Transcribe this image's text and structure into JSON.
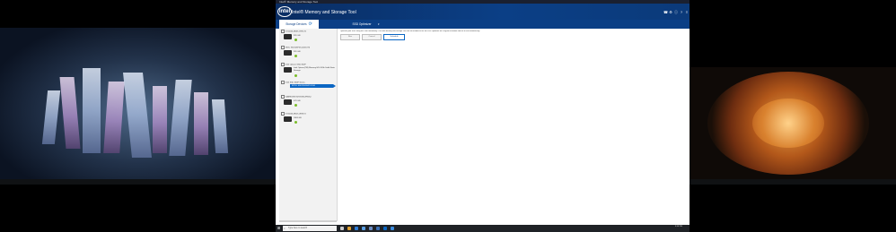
{
  "window": {
    "title": "Intel® Memory and Storage Tool",
    "app_title": "Intel® Memory and Storage Tool",
    "logo_text": "intel"
  },
  "header_icons": [
    "phone-icon",
    "gear-icon",
    "info-icon",
    "question-icon",
    "user-icon",
    "menu-icon"
  ],
  "tabs": {
    "storage_devices": "Storage Devices",
    "ssd_optimizer": "SSD Optimizer"
  },
  "sidebar": {
    "drives": [
      {
        "heading": "ST1000LM035-1RK172",
        "size": "931 GB",
        "model": ""
      },
      {
        "heading": "WDC WD10SPZX-00Z10T0",
        "size": "931 GB",
        "model": ""
      },
      {
        "heading": "Intel Optane SSD 800P",
        "size": "",
        "model": "Intel Optane(TM) Memory H10 With Solid State Storage"
      },
      {
        "heading": "Intel SSD 660P Series",
        "size": "",
        "model": "INTEL SSDPEKNW512G8",
        "selected": true
      },
      {
        "heading": "SAMSUNG MZVLB512HBJQ",
        "size": "476 GB",
        "model": ""
      },
      {
        "heading": "ST2000LM015-2E8174",
        "size": "1863 GB",
        "model": ""
      }
    ]
  },
  "main": {
    "description": "Optimize your SSD using the Trim functionality. The Intel Memory and Storage Tool can be enabled to run the SSD Optimizer on a regular schedule and set to run automatically.",
    "buttons": {
      "run": "Run",
      "cancel": "Cancel",
      "optimize": "Schedule"
    }
  },
  "taskbar": {
    "search_placeholder": "Type here to search",
    "time": "3:35 PM",
    "date": "9/1/2020"
  },
  "colors": {
    "header_blue": "#0b3f86",
    "accent_blue": "#0b66c3",
    "status_green": "#7bbd2a"
  }
}
